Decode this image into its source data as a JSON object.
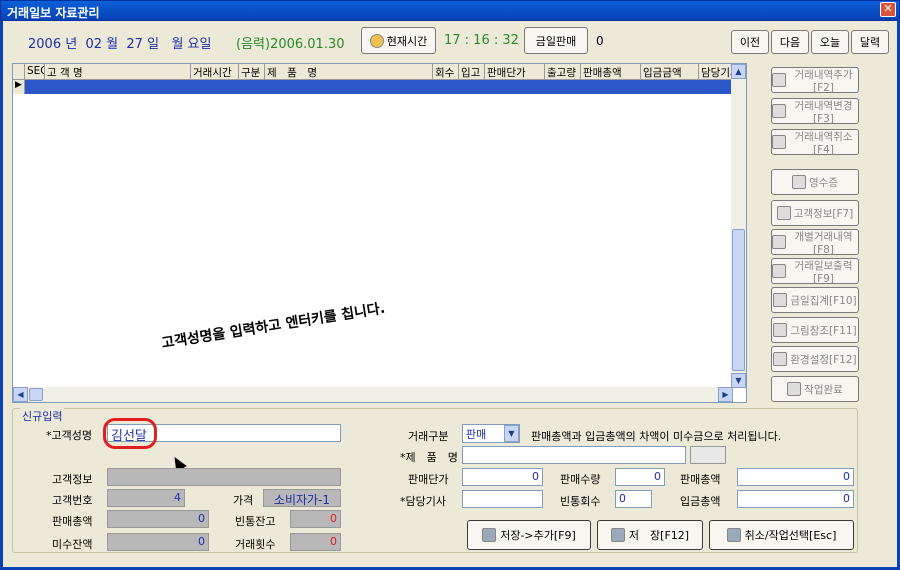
{
  "window": {
    "title": "거래일보 자료관리",
    "close": "✕"
  },
  "date": {
    "year": "2006",
    "year_unit": "년",
    "month": "02",
    "month_unit": "월",
    "day": "27",
    "day_unit": "일",
    "weekday": "월 요일",
    "lunar": "(음력)2006.01.30",
    "time_button": "현재시간",
    "time": "17 : 16 : 32",
    "today_button": "금일판매",
    "today_count": "0"
  },
  "nav": {
    "prev": "이전",
    "next": "다음",
    "today": "오늘",
    "calendar": "달력"
  },
  "grid": {
    "headers": [
      "SEQ",
      "고 객 명",
      "거래시간",
      "구분",
      "제　품　명",
      "회수",
      "입고",
      "판매단가",
      "출고량",
      "판매총액",
      "입금금액",
      "담당기사"
    ],
    "row_marker": "▶"
  },
  "toolbar": [
    {
      "label": "거래내역추가[F2]"
    },
    {
      "label": "거래내역변경[F3]"
    },
    {
      "label": "거래내역취소[F4]"
    },
    {
      "label": "영수증"
    },
    {
      "label": "고객정보[F7]"
    },
    {
      "label": "개별거래내역[F8]"
    },
    {
      "label": "거래일보출력[F9]"
    },
    {
      "label": "금일집계[F10]"
    },
    {
      "label": "그림참조[F11]"
    },
    {
      "label": "환경설정[F12]"
    },
    {
      "label": "작업완료"
    }
  ],
  "form": {
    "group_title": "신규입력",
    "customer_name_label": "*고객성명",
    "customer_name_value": "김선달",
    "customer_info_label": "고객정보",
    "customer_no_label": "고객번호",
    "customer_no": "4",
    "price_label": "가격",
    "price_value": "소비자가-1",
    "sales_total_label": "판매총액",
    "sales_total": "0",
    "empty_balance_label": "빈통잔고",
    "empty_balance": "0",
    "unpaid_label": "미수잔액",
    "unpaid": "0",
    "trade_count_label": "거래횟수",
    "trade_count": "0",
    "trade_type_label": "거래구분",
    "trade_type_value": "판매",
    "note": "판매총액과 입금총액의 차액이 미수금으로 처리됩니다.",
    "product_label": "*제　품　명",
    "unit_price_label": "판매단가",
    "unit_price": "0",
    "qty_label": "판매수량",
    "qty": "0",
    "total_label": "판매총액",
    "total": "0",
    "driver_label": "*담당기사",
    "empty_return_label": "빈통회수",
    "empty_return": "0",
    "deposit_label": "입금총액",
    "deposit": "0"
  },
  "actions": {
    "save_add": "저장->추가[F9]",
    "save": "저　장[F12]",
    "cancel": "취소/작업선택[Esc]"
  },
  "annotation": "고객성명을 입력하고 엔터키를 칩니다."
}
